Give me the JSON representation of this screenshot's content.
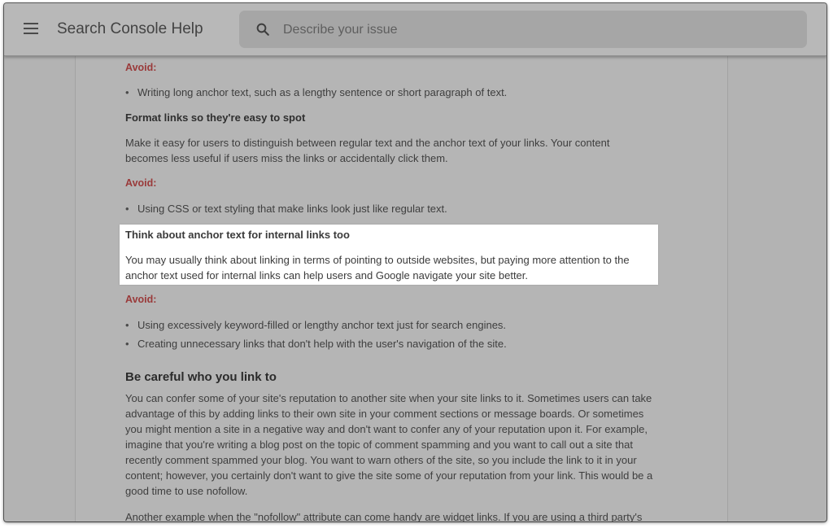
{
  "header": {
    "app_title": "Search Console Help",
    "search_placeholder": "Describe your issue"
  },
  "article": {
    "avoid_label": "Avoid:",
    "line_avoid_long_text": "Writing long anchor text, such as a lengthy sentence or short paragraph of text.",
    "heading_format_links": "Format links so they're easy to spot",
    "format_links_p1": "Make it easy for users to distinguish between regular text and the anchor text of your links. Your content",
    "format_links_p2": "becomes less useful if users miss the links or accidentally click them.",
    "line_avoid_css": "Using CSS or text styling that make links look just like regular text.",
    "highlight_title": "Think about anchor text for internal links too",
    "highlight_body": "You may usually think about linking in terms of pointing to outside websites, but paying more attention to the anchor text used for internal links can help users and Google navigate your site better.",
    "line_avoid_keyword": "Using excessively keyword-filled or lengthy anchor text just for search engines.",
    "line_avoid_unnecessary": "Creating unnecessary links that don't help with the user's navigation of the site.",
    "heading_careful": "Be careful who you link to",
    "careful_lines": [
      "You can confer some of your site's reputation to another site when your site links to it. Sometimes users can take",
      "advantage of this by adding links to their own site in your comment sections or message boards. Or sometimes",
      "you might mention a site in a negative way and don't want to confer any of your reputation upon it. For example,",
      "imagine that you're writing a blog post on the topic of comment spamming and you want to call out a site that",
      "recently comment spammed your blog. You want to warn others of the site, so you include the link to it in your",
      "content; however, you certainly don't want to give the site some of your reputation from your link. This would be a",
      "good time to use nofollow."
    ],
    "another_example": "Another example when the \"nofollow\" attribute can come handy are widget links. If you are using a third party's"
  },
  "colors": {
    "overlay_gray": "#b3b3b3",
    "avoid_red": "#9a3a3a",
    "highlight_bg": "#ffffff"
  },
  "icons": [
    "menu-icon",
    "search-icon"
  ]
}
